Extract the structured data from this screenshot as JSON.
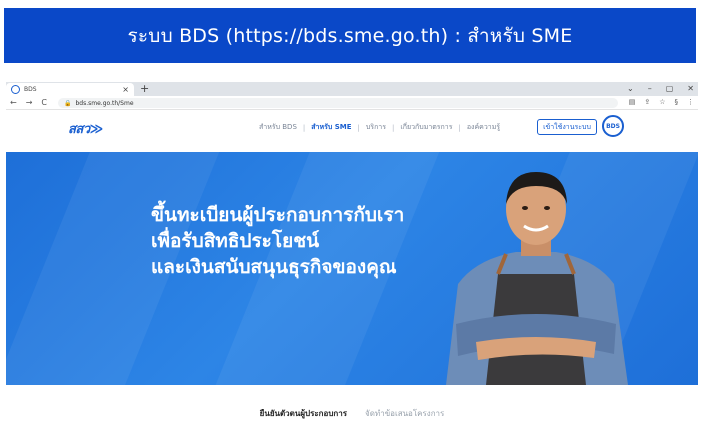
{
  "banner": {
    "title": "ระบบ BDS (https://bds.sme.go.th) : สำหรับ SME"
  },
  "browser": {
    "tab_title": "BDS",
    "tab_close": "×",
    "new_tab": "+",
    "window_controls": [
      "⌄",
      "–",
      "▢",
      "✕"
    ],
    "url": "bds.sme.go.th/Sme",
    "nav": {
      "back": "←",
      "forward": "→",
      "reload": "C"
    }
  },
  "site": {
    "logo": "สสว≫",
    "menu": [
      {
        "label": "สำหรับ BDS",
        "active": false
      },
      {
        "label": "สำหรับ SME",
        "active": true
      },
      {
        "label": "บริการ",
        "active": false
      },
      {
        "label": "เกี่ยวกับมาตรการ",
        "active": false
      },
      {
        "label": "องค์ความรู้",
        "active": false
      }
    ],
    "login_label": "เข้าใช้งานระบบ",
    "badge_label": "BDS"
  },
  "hero": {
    "lines": [
      "ขึ้นทะเบียนผู้ประกอบการกับเรา",
      "เพื่อรับสิทธิประโยชน์",
      "และเงินสนับสนุนธุรกิจของคุณ"
    ],
    "bg_color": "#2278dd"
  },
  "bottom_tabs": [
    {
      "label": "ยืนยันตัวตนผู้ประกอบการ",
      "active": true
    },
    {
      "label": "จัดทำข้อเสนอโครงการ",
      "active": false
    }
  ],
  "colors": {
    "banner": "#0a48c8",
    "accent": "#1a5fd0"
  }
}
